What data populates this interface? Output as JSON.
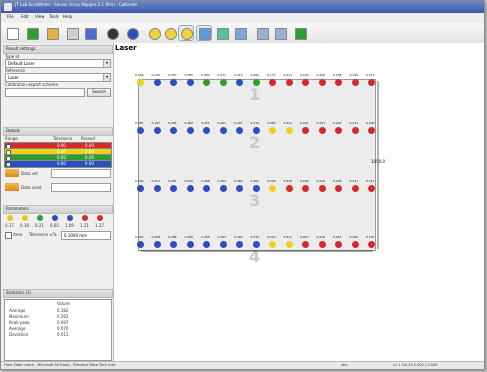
{
  "window": {
    "title": "JT Lab ScanWriter - Sensor Array Mapper 2.1 (Pro) - Calibrate"
  },
  "menu": [
    "File",
    "Edit",
    "View",
    "Tools",
    "Help"
  ],
  "toolbar_icons": [
    "new-icon",
    "open-icon",
    "save-icon",
    "print-icon",
    "export-icon",
    "run-icon",
    "info-icon",
    "smile-icon",
    "smile-icon",
    "grid-icon",
    "chart-icon",
    "map-icon",
    "table-icon",
    "zoom-in-icon",
    "zoom-out-icon",
    "globe-icon"
  ],
  "panel": {
    "section1": "Result settings",
    "label_type": "Type id",
    "type_value": "Default Laser",
    "label_ref": "Reference",
    "ref_value": "Laser",
    "label_scheme": "Calibration export scheme",
    "search_label": "Search",
    "section2": "Details",
    "status_headers": [
      "Range",
      "Tolerance",
      "Passed"
    ],
    "status_rows": [
      {
        "a": "",
        "b": "0.00",
        "c": "0.00",
        "color": "#d62b2b"
      },
      {
        "a": "",
        "b": "0.00",
        "c": "0.00",
        "color": "#eed21a"
      },
      {
        "a": "",
        "b": "0.00",
        "c": "0.00",
        "color": "#2f9d2f"
      },
      {
        "a": "",
        "b": "0.00",
        "c": "0.00",
        "color": "#2a4fc1"
      }
    ],
    "option1": "Data set",
    "option2": "Data used",
    "section3": "Parameters",
    "legend_vals": [
      "0.17",
      "0.18",
      "0.21",
      "0.65",
      "1.09",
      "1.21",
      "1.27"
    ],
    "legend_colors": [
      "#e6c81a",
      "#e6c81a",
      "#2f9d2f",
      "#2a4fc1",
      "#2a4fc1",
      "#d62b2b",
      "#d62b2b"
    ],
    "check_label": "Area",
    "tol_label": "Tolerance ±%",
    "tol_value": "0.1000 mm",
    "section4": "Statistics (1)",
    "stats_header": "Values",
    "stats": [
      {
        "k": "Average",
        "v": "0.182"
      },
      {
        "k": "Maximum",
        "v": "0.262"
      },
      {
        "k": "Peak-peak",
        "v": "0.097"
      },
      {
        "k": "Average",
        "v": "0.070"
      },
      {
        "k": "Deviation",
        "v": "0.013"
      }
    ]
  },
  "canvas": {
    "title": "Laser",
    "dimension_label": "1050.0",
    "rows": [
      {
        "num": "1",
        "vals": [
          "0.298",
          "0.245",
          "0.253",
          "0.285",
          "0.300",
          "0.271",
          "0.210",
          "0.205",
          "0.173",
          "0.211",
          "0.229",
          "0.226",
          "0.184",
          "0.220",
          "0.213"
        ],
        "colors": [
          "yellow",
          "blue",
          "blue",
          "blue",
          "green",
          "green",
          "blue",
          "green",
          "red",
          "red",
          "red",
          "red",
          "red",
          "red",
          "red"
        ]
      },
      {
        "num": "2",
        "vals": [
          "0.287",
          "0.197",
          "0.265",
          "0.300",
          "0.251",
          "0.261",
          "0.297",
          "0.270",
          "0.200",
          "0.211",
          "0.227",
          "0.231",
          "0.201",
          "0.211",
          "0.200"
        ],
        "colors": [
          "blue",
          "blue",
          "blue",
          "blue",
          "blue",
          "blue",
          "blue",
          "blue",
          "yellow",
          "yellow",
          "red",
          "red",
          "red",
          "red",
          "red"
        ]
      },
      {
        "num": "3",
        "vals": [
          "0.204",
          "0.251",
          "0.281",
          "0.290",
          "0.268",
          "0.253",
          "0.264",
          "0.267",
          "0.206",
          "0.215",
          "0.244",
          "0.219",
          "0.236",
          "0.217",
          "0.217"
        ],
        "colors": [
          "blue",
          "blue",
          "blue",
          "blue",
          "blue",
          "blue",
          "blue",
          "blue",
          "yellow",
          "red",
          "red",
          "red",
          "red",
          "red",
          "red"
        ]
      },
      {
        "num": "4",
        "vals": [
          "0.262",
          "0.228",
          "0.288",
          "0.280",
          "0.255",
          "0.297",
          "0.209",
          "0.179",
          "0.212",
          "0.211",
          "0.217",
          "0.216",
          "0.215",
          "0.200",
          "0.197"
        ],
        "colors": [
          "blue",
          "blue",
          "blue",
          "blue",
          "blue",
          "blue",
          "blue",
          "blue",
          "yellow",
          "yellow",
          "red",
          "red",
          "red",
          "red",
          "red"
        ]
      }
    ]
  },
  "colors": {
    "red": "#d62b2b",
    "yellow": "#eed21a",
    "green": "#2f9d2f",
    "blue": "#2a4fc1"
  },
  "statusbar": {
    "left": "Flow: Data coach - Microsoft All Hosts - Effective Data Tech mail",
    "mid": "Idle",
    "right": "Ln 1 Col 29  0.002 | 0.000"
  }
}
